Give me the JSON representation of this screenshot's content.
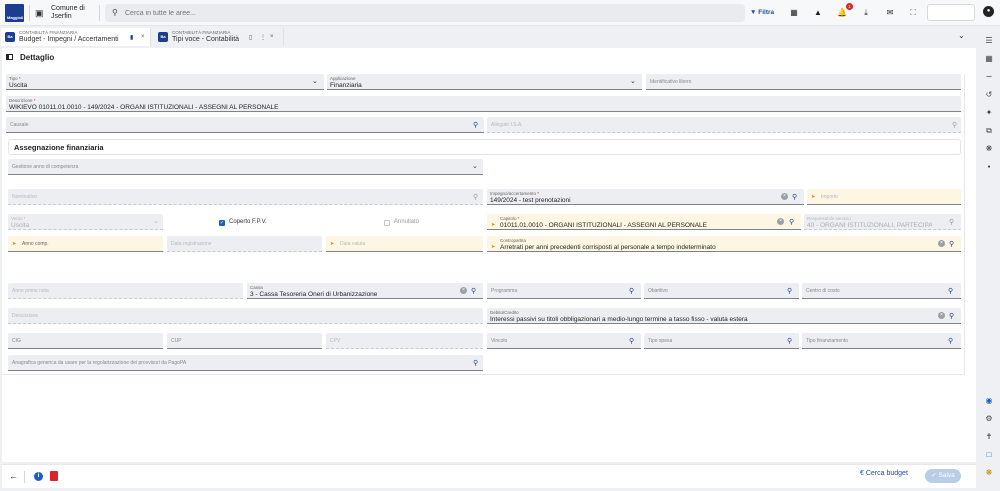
{
  "topbar": {
    "logo_text": "Maggioli",
    "org_name": "Comune di Jserfin",
    "search_placeholder": "Cerca in tutte le aree...",
    "filter_label": "Filtra",
    "notification_count": "1"
  },
  "tabs": [
    {
      "subtitle": "CONTABILITÀ FINANZIARIA",
      "title": "Budget - Impegni / Accertamenti",
      "active": true
    },
    {
      "subtitle": "CONTABILITÀ FINANZIARIA",
      "title": "Tipi voce - Contabilità",
      "active": false
    }
  ],
  "panel": {
    "title": "Dettaglio",
    "tipo": {
      "label": "Tipo",
      "value": "Uscita"
    },
    "applicazione": {
      "label": "Applicazione",
      "value": "Finanziaria"
    },
    "identificativo": {
      "placeholder": "Identificativo libero"
    },
    "descrizione": {
      "label": "Descrizione",
      "value": "WIKIEVO 01011.01.0010 - 149/2024 - ORGANI ISTITUZIONALI - ASSEGNI AL PERSONALE"
    },
    "causale": {
      "placeholder": "Causale"
    },
    "allegato": {
      "placeholder": "Allegato I.S.A."
    }
  },
  "assegnazione": {
    "title": "Assegnazione finanziaria",
    "gestione": {
      "placeholder": "Gestione anno di competenza"
    },
    "nominativo": {
      "placeholder": "Nominativo"
    },
    "impegno": {
      "label": "Impegno/accertamento",
      "value": "149/2024 - test prenotazioni"
    },
    "importo": {
      "placeholder": "Importo"
    },
    "verso": {
      "label": "Verso",
      "value": "Uscita"
    },
    "coperto": {
      "label": "Coperto F.P.V.",
      "checked": true
    },
    "annullato": {
      "label": "Annullato",
      "checked": false
    },
    "capitolo": {
      "label": "Capitolo",
      "value": "01011.01.0010 - ORGANI ISTITUZIONALI - ASSEGNI AL PERSONALE"
    },
    "responsabile": {
      "label": "Responsabile servizio",
      "value": "40 - ORGANI ISTITUZIONALI, PARTECIPAZIO..."
    },
    "anno_comp": {
      "placeholder": "Anno comp."
    },
    "data_registrazione": {
      "placeholder": "Data registrazione"
    },
    "data_valuta": {
      "placeholder": "Data valuta"
    },
    "contropartita": {
      "label": "Contropartita",
      "value": "Arretrati per anni precedenti corrisposti al personale a tempo indeterminato"
    },
    "anno_prima_nota": {
      "placeholder": "Anno prima nota"
    },
    "cassa": {
      "label": "Cassa",
      "value": "3 - Cassa Tesoreria Oneri di Urbanizzazione"
    },
    "programma": {
      "placeholder": "Programma"
    },
    "obiettivo": {
      "placeholder": "Obiettivo"
    },
    "centro_costo": {
      "placeholder": "Centro di costo"
    },
    "descrizione2": {
      "placeholder": "Descrizione"
    },
    "debito_credito": {
      "label": "Debito/Credito",
      "value": "Interessi passivi su titoli obbligazionari a medio-lungo termine a tasso fisso - valuta estera"
    },
    "cig": {
      "placeholder": "CIG"
    },
    "cup": {
      "placeholder": "CUP"
    },
    "cpv": {
      "placeholder": "CPV"
    },
    "vincolo": {
      "placeholder": "Vincolo"
    },
    "tipo_spesa": {
      "placeholder": "Tipo spesa"
    },
    "tipo_finanziamento": {
      "placeholder": "Tipo finanziamento"
    },
    "anagrafica": {
      "placeholder": "Anagrafica generica da usare per la regolarizzazione dei provvisori da PagoPA"
    }
  },
  "footer": {
    "cerca_budget": "Cerca budget",
    "salva": "Salva"
  },
  "colors": {
    "accent": "#1b5ec7",
    "brand": "#1b3e91",
    "warn_bg": "#fdf6e3",
    "danger": "#d6262b"
  }
}
